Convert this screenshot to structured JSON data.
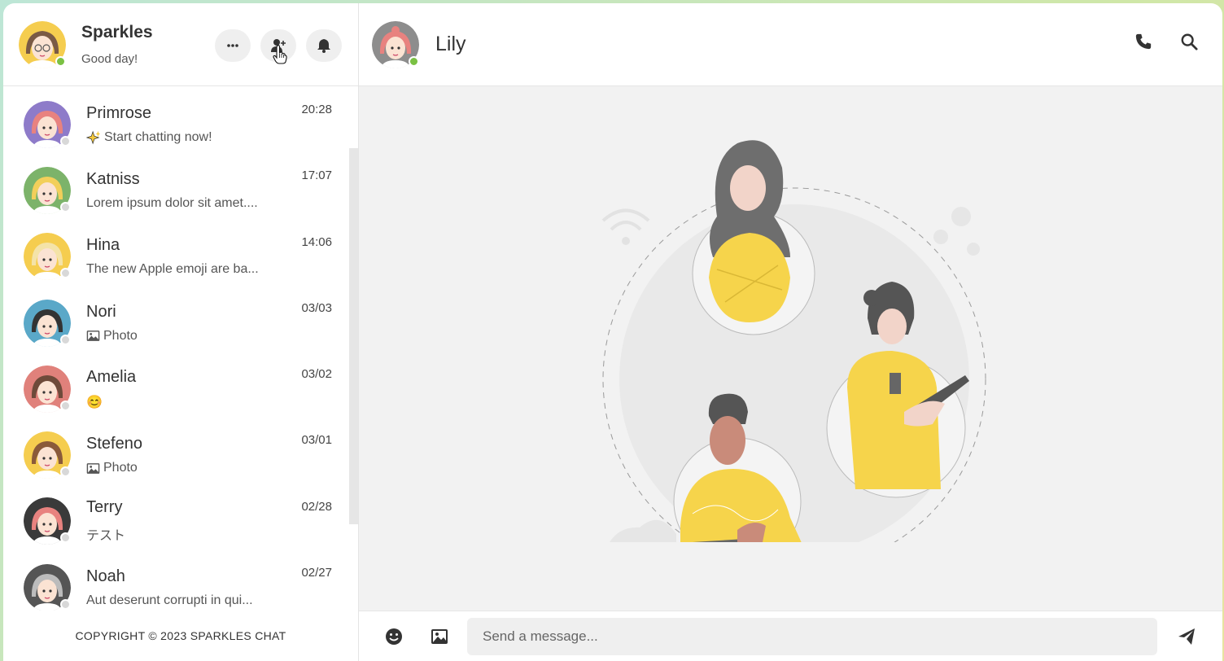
{
  "user": {
    "name": "Sparkles",
    "status": "Good day!"
  },
  "contacts": [
    {
      "name": "Primrose",
      "preview": "Start chatting now!",
      "preview_icon": "sparkles-icon",
      "time": "20:28",
      "avatar_bg": "#8e7bc9",
      "hair": "#e8827f"
    },
    {
      "name": "Katniss",
      "preview": "Lorem ipsum dolor sit amet....",
      "time": "17:07",
      "avatar_bg": "#7cb36a",
      "hair": "#f2cf5a"
    },
    {
      "name": "Hina",
      "preview": "The new Apple emoji are ba...",
      "time": "14:06",
      "avatar_bg": "#f5cd4f",
      "hair": "#f4e3a8"
    },
    {
      "name": "Nori",
      "preview": "Photo",
      "preview_icon": "image-icon",
      "time": "03/03",
      "avatar_bg": "#5aa8c8",
      "hair": "#333333"
    },
    {
      "name": "Amelia",
      "preview": "😊",
      "time": "03/02",
      "avatar_bg": "#e0817b",
      "hair": "#6e4a3a"
    },
    {
      "name": "Stefeno",
      "preview": "Photo",
      "preview_icon": "image-icon",
      "time": "03/01",
      "avatar_bg": "#f5cd4f",
      "hair": "#8a5a3a"
    },
    {
      "name": "Terry",
      "preview": "テスト",
      "time": "02/28",
      "avatar_bg": "#3a3a3a",
      "hair": "#e8827f"
    },
    {
      "name": "Noah",
      "preview": "Aut deserunt corrupti in qui...",
      "time": "02/27",
      "avatar_bg": "#555555",
      "hair": "#bcbcbc"
    }
  ],
  "footer": "COPYRIGHT © 2023 SPARKLES CHAT",
  "chat": {
    "name": "Lily"
  },
  "composer": {
    "placeholder": "Send a message..."
  },
  "colors": {
    "online": "#7ac143",
    "offline": "#d8d8d8",
    "accent_yellow": "#f6d44b"
  }
}
